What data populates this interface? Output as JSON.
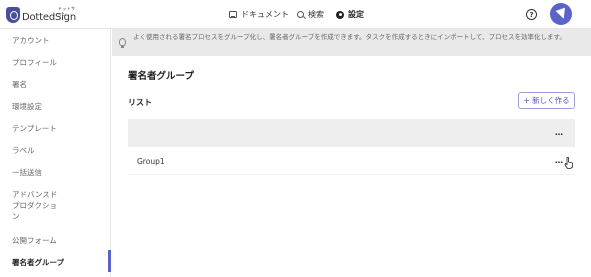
{
  "header": {
    "logo_text": "DottedSign",
    "logo_ruby": "ドットサイン",
    "nav": [
      {
        "label": "ドキュメント",
        "icon": "document-icon"
      },
      {
        "label": "検索",
        "icon": "search-icon"
      },
      {
        "label": "設定",
        "icon": "gear-icon",
        "active": true
      }
    ],
    "help_label": "?",
    "avatar_icon": "user-avatar-icon"
  },
  "sidebar": {
    "items": [
      {
        "label": "アカウント"
      },
      {
        "label": "プロフィール"
      },
      {
        "label": "署名"
      },
      {
        "label": "環境設定"
      },
      {
        "label": "テンプレート"
      },
      {
        "label": "ラベル"
      },
      {
        "label": "一括送信"
      },
      {
        "label": "アドバンスド\nプロダクショ\nン"
      },
      {
        "label": "公開フォーム"
      },
      {
        "label": "署名者グループ",
        "active": true
      }
    ]
  },
  "main": {
    "info_text": "よく使用される署名プロセスをグループ化し、署名者グループを作成できます。タスクを作成するときにインポートして、プロセスを効率化します。",
    "page_title": "署名者グループ",
    "list_label": "リスト",
    "new_button": "+ 新しく作る",
    "table": {
      "header_more": "…",
      "rows": [
        {
          "name": "Group1",
          "more": "…"
        }
      ]
    }
  },
  "colors": {
    "accent": "#5a63c8",
    "button_border": "#9aa0d8",
    "info_bar": "#e9e9e9",
    "table_header": "#eeeeee"
  }
}
